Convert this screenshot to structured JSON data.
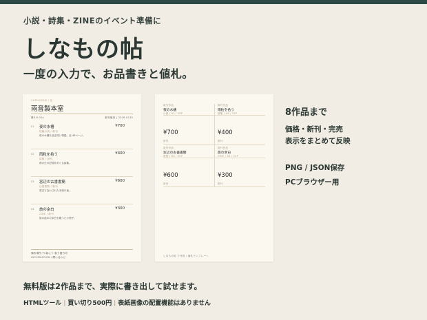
{
  "header": {
    "eyebrow": "小説・詩集・ZINEのイベント準備に",
    "title": "しなもの帖",
    "subtitle": "一度の入力で、お品書きと値札。"
  },
  "colors": {
    "top_bar": "#2e4a46",
    "background": "#f1ede4",
    "card": "#fbf8f0"
  },
  "preview_left": {
    "head_label": "CATALOGUE / 目",
    "title": "雨音製本室",
    "sub_left": "第3.8.01a",
    "sub_right": "新刊案内  |  2026-0130",
    "items": [
      {
        "num": "01",
        "name": "夜の水槽",
        "price": "¥700",
        "meta": "短編小説 / 新刊",
        "desc": "夜の水槽を巡る短い物語。全 48ページ。"
      },
      {
        "num": "02",
        "name": "雨粒を拾う",
        "price": "¥400",
        "meta": "詩集 / 既刊",
        "desc": "雨の日の記憶をめぐる詩集。"
      },
      {
        "num": "03",
        "name": "窓辺の古書書簡",
        "price": "¥600",
        "meta": "往復書簡 / 新刊",
        "desc": "窓辺で交わされた手紙の束。"
      },
      {
        "num": "04",
        "name": "旅の余白",
        "price": "¥300",
        "meta": "ZINE / 既刊",
        "desc": "旅の途中の余白を綴った小冊子。"
      }
    ],
    "footer_1": "頒布場所 PC版にて 取り置き可",
    "footer_2": "INFORMATION / 問い合わせ"
  },
  "preview_right": {
    "tiles": [
      {
        "tag": "新刊作品",
        "name": "夜の水槽",
        "meta": "小説 / A5 / 48P",
        "price": "¥700",
        "foot": "新刊"
      },
      {
        "tag": "既刊作品",
        "name": "雨粒を拾う",
        "meta": "詩集 / A6 / 32P",
        "price": "¥400",
        "foot": "既刊"
      },
      {
        "tag": "新刊作品",
        "name": "窓辺の古書書簡",
        "meta": "書簡 / B6 / 40P",
        "price": "¥600",
        "foot": "新刊"
      },
      {
        "tag": "既刊作品",
        "name": "旅の余白",
        "meta": "ZINE / A6 / 24P",
        "price": "¥300",
        "foot": "既刊"
      }
    ],
    "footer": "しなもの帖 で作成 / 値札テンプレート"
  },
  "features": {
    "heading": "8作品まで",
    "line1": "価格・新刊・完売",
    "line2": "表示をまとめて反映",
    "line3": "PNG / JSON保存",
    "line4": "PCブラウザー用"
  },
  "footer": {
    "main": "無料版は2作品まで、実際に書き出して試せます。",
    "sub_items": [
      "HTMLツール",
      "買い切り500円",
      "表紙画像の配置機能はありません"
    ]
  }
}
